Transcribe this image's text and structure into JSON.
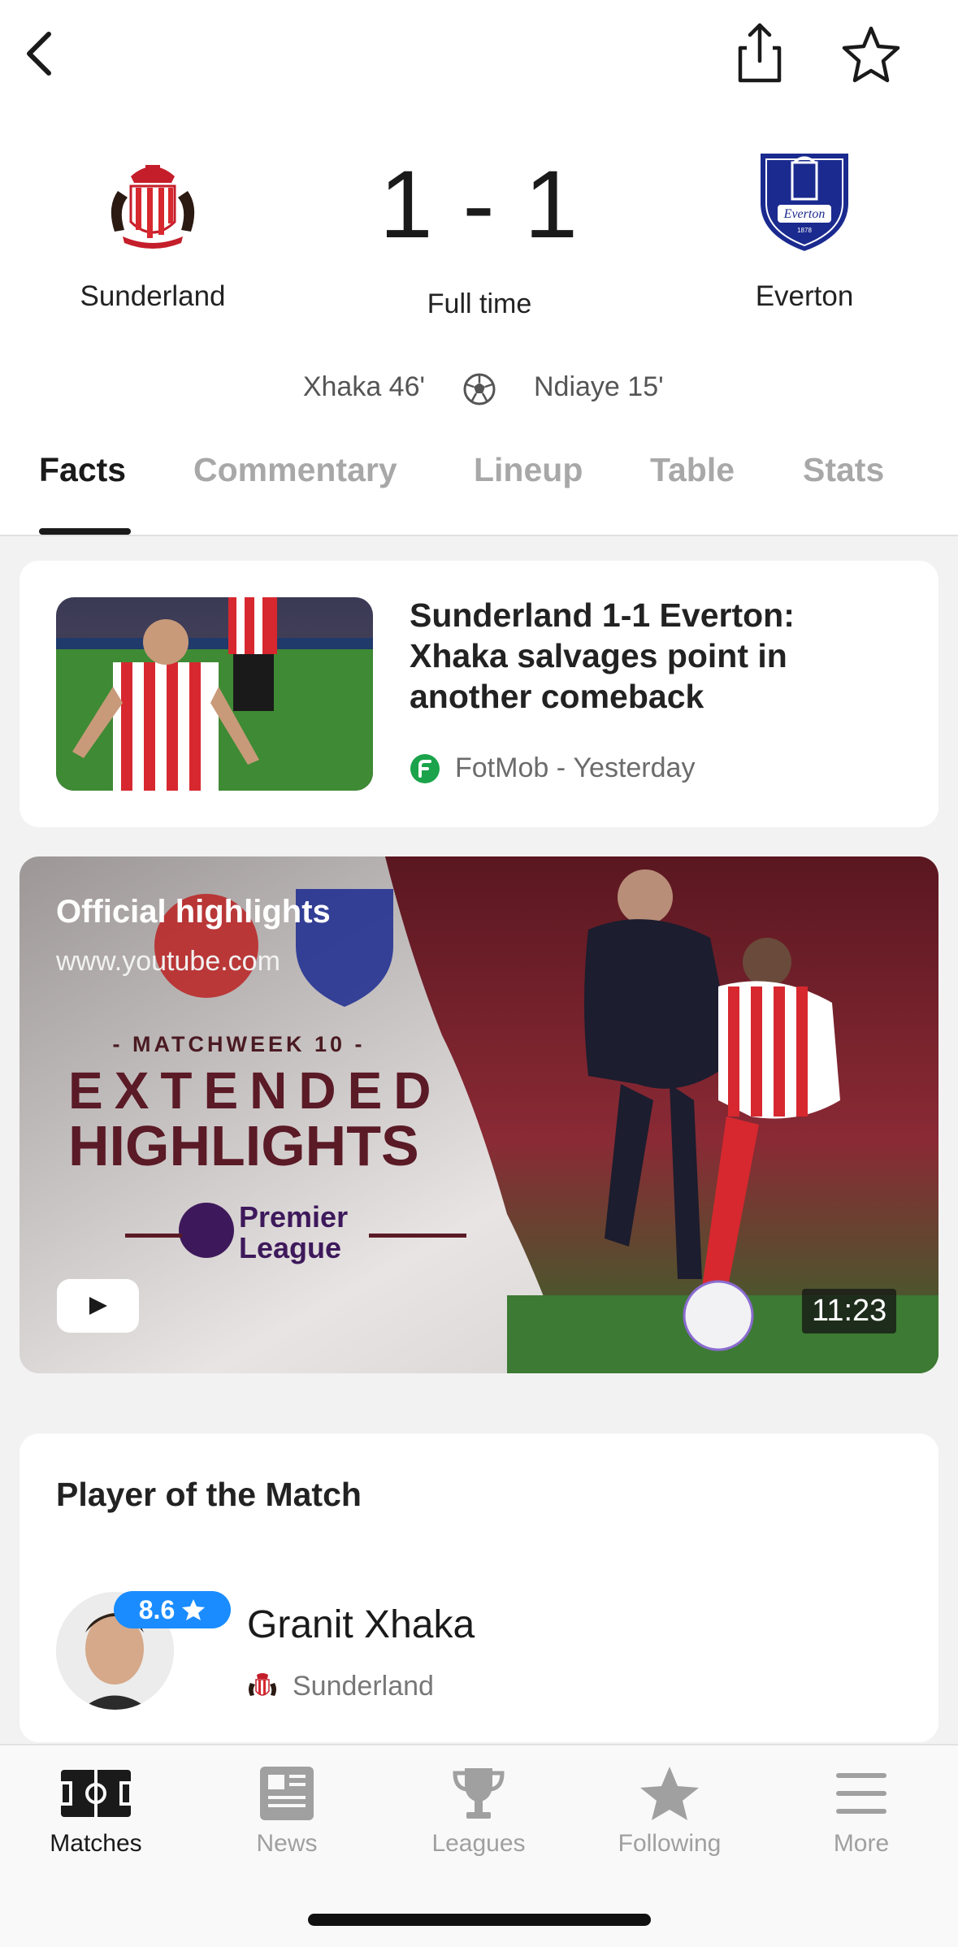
{
  "match": {
    "home_team": "Sunderland",
    "away_team": "Everton",
    "score": "1 - 1",
    "status": "Full time",
    "home_scorer": "Xhaka 46'",
    "away_scorer": "Ndiaye 15'"
  },
  "tabs": [
    {
      "label": "Facts",
      "active": true
    },
    {
      "label": "Commentary",
      "active": false
    },
    {
      "label": "Lineup",
      "active": false
    },
    {
      "label": "Table",
      "active": false
    },
    {
      "label": "Stats",
      "active": false
    }
  ],
  "news": {
    "title": "Sunderland 1-1 Everton: Xhaka salvages point in another comeback",
    "source": "FotMob",
    "separator": " - ",
    "time": "Yesterday"
  },
  "video": {
    "title": "Official highlights",
    "source": "www.youtube.com",
    "duration": "11:23",
    "thumbnail_text": {
      "matchweek": "- MATCHWEEK 10 -",
      "line1": "EXTENDED",
      "line2": "HIGHLIGHTS",
      "league_line1": "Premier",
      "league_line2": "League"
    }
  },
  "potm": {
    "heading": "Player of the Match",
    "player_name": "Granit Xhaka",
    "rating": "8.6",
    "team": "Sunderland"
  },
  "nav": [
    {
      "label": "Matches",
      "icon": "pitch-icon",
      "active": true
    },
    {
      "label": "News",
      "icon": "newspaper-icon",
      "active": false
    },
    {
      "label": "Leagues",
      "icon": "trophy-icon",
      "active": false
    },
    {
      "label": "Following",
      "icon": "star-icon",
      "active": false
    },
    {
      "label": "More",
      "icon": "menu-icon",
      "active": false
    }
  ],
  "colors": {
    "accent_blue": "#1a8cff",
    "fotmob_green": "#1aa34a",
    "sunderland_red": "#d7282f",
    "everton_blue": "#1b2a8f"
  }
}
